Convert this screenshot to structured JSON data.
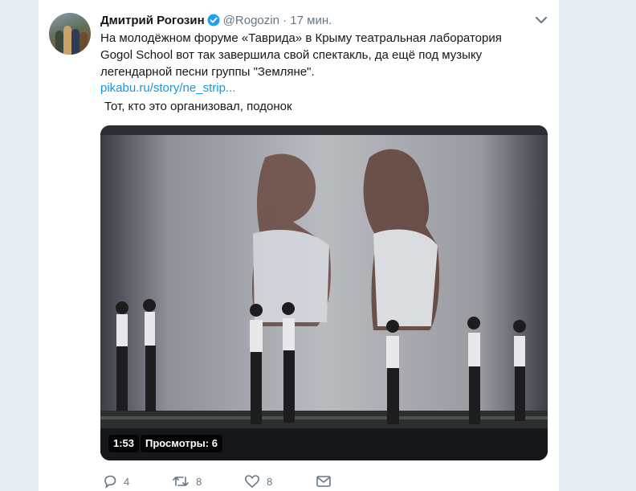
{
  "tweet": {
    "author_name": "Дмитрий Рогозин",
    "handle": "@Rogozin",
    "separator": "·",
    "time": "17 мин.",
    "text": "На молодёжном форуме «Таврида» в Крыму театральная лаборатория Gogol School вот так завершила свой спектакль, да ещё под музыку легендарной песни группы \"Земляне\".",
    "link": "pikabu.ru/story/ne_strip...",
    "quote_text": "Тот, кто это организовал, подонок"
  },
  "video": {
    "duration": "1:53",
    "views": "Просмотры: 6"
  },
  "actions": {
    "reply_count": "4",
    "retweet_count": "8",
    "like_count": "8"
  },
  "colors": {
    "accent": "#1b95e0",
    "verified": "#1da1f2",
    "muted": "#657786",
    "page_bg": "#e6ecf0"
  },
  "icons": [
    "verified-badge-icon",
    "chevron-down-icon",
    "reply-icon",
    "retweet-icon",
    "like-icon",
    "direct-message-icon"
  ]
}
